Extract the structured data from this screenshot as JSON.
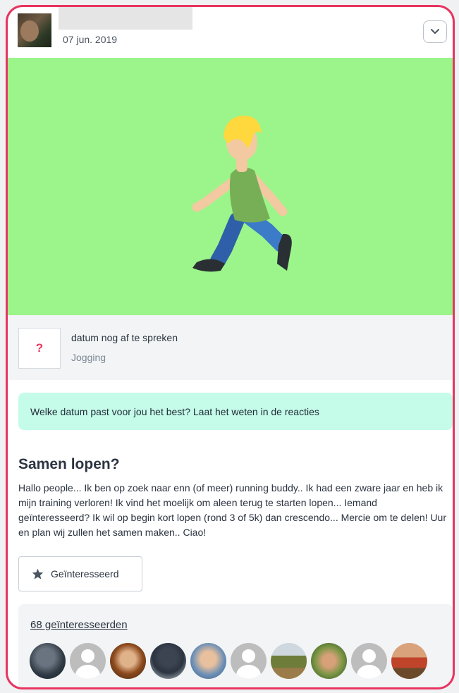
{
  "post": {
    "date": "07 jun. 2019",
    "event_date_icon": "?",
    "event_date_text": "datum nog af te spreken",
    "category": "Jogging",
    "notice": "Welke datum past voor jou het best? Laat het weten in de reacties",
    "title": "Samen lopen?",
    "body": "Hallo people... Ik ben op zoek naar enn (of meer) running buddy.. Ik had een zware jaar en heb ik mijn training verloren! Ik vind het moelijk om aleen terug te starten lopen... Iemand geïnteresseerd? Ik wil op begin kort lopen (rond 3 of 5k) dan crescendo... Mercie om te delen! Uur en plan wij zullen het samen maken.. Ciao!",
    "interested_button_label": "Geïnteresseerd",
    "interested_count_label": "68 geïnteresseerden"
  },
  "icons": {
    "menu": "chevron-down-icon",
    "hero": "person-running-icon",
    "interest": "star-icon"
  },
  "colors": {
    "card_border": "#e8345f",
    "hero_background": "#9cf58a",
    "notice_background": "#c5fbe9",
    "accent": "#e8345f"
  },
  "interested_users": [
    {
      "type": "photo"
    },
    {
      "type": "placeholder"
    },
    {
      "type": "photo"
    },
    {
      "type": "photo"
    },
    {
      "type": "photo"
    },
    {
      "type": "placeholder"
    },
    {
      "type": "photo"
    },
    {
      "type": "photo"
    },
    {
      "type": "placeholder"
    },
    {
      "type": "photo"
    }
  ]
}
